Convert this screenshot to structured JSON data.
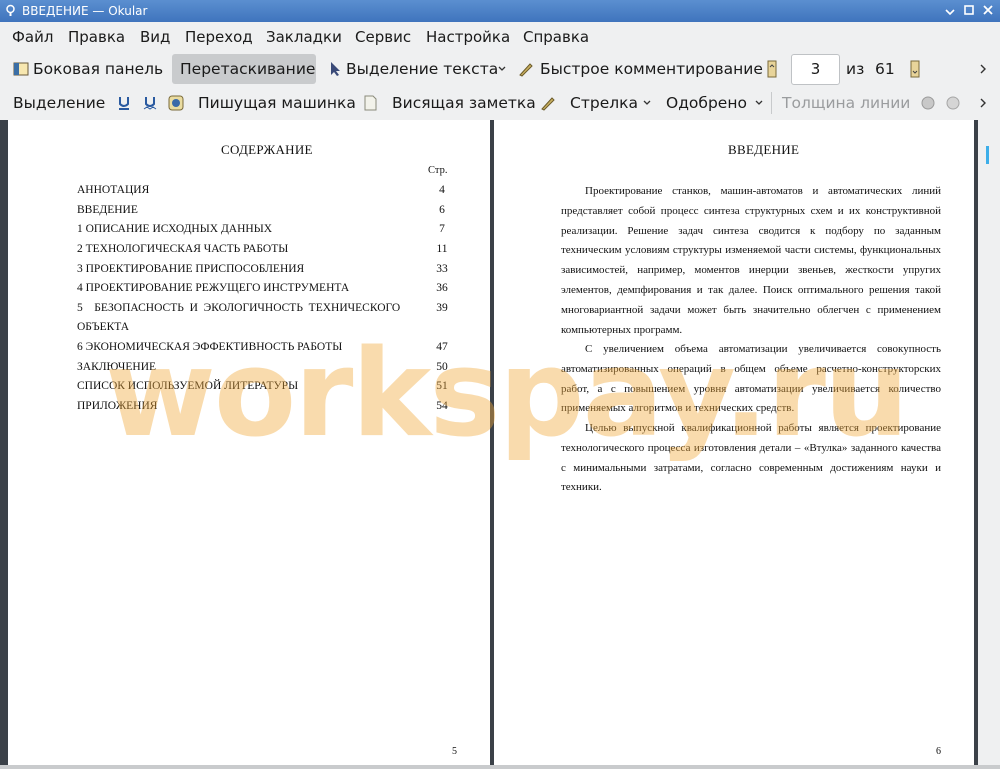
{
  "window": {
    "title": "ВВЕДЕНИЕ  — Okular"
  },
  "menu": [
    "Файл",
    "Правка",
    "Вид",
    "Переход",
    "Закладки",
    "Сервис",
    "Настройка",
    "Справка"
  ],
  "toolbar1": {
    "sidebar": "Боковая панель",
    "drag": "Перетаскивание",
    "text_select": "Выделение текста",
    "quick_comment": "Быстрое комментирование",
    "page_current": "3",
    "page_of": "из",
    "page_total": "61"
  },
  "toolbar2": {
    "selection": "Выделение",
    "typewriter": "Пишущая машинка",
    "hanging_note": "Висящая заметка",
    "arrow": "Стрелка",
    "approved": "Одобрено",
    "line_width": "Толщина линии"
  },
  "left_page": {
    "heading": "СОДЕРЖАНИЕ",
    "col_header": "Стр.",
    "toc": [
      {
        "title": "АННОТАЦИЯ",
        "page": "4"
      },
      {
        "title": "ВВЕДЕНИЕ",
        "page": "6"
      },
      {
        "title": "1  ОПИСАНИЕ ИСХОДНЫХ ДАННЫХ",
        "page": "7"
      },
      {
        "title": "2  ТЕХНОЛОГИЧЕСКАЯ ЧАСТЬ РАБОТЫ",
        "page": "11"
      },
      {
        "title": "3  ПРОЕКТИРОВАНИЕ ПРИСПОСОБЛЕНИЯ",
        "page": "33"
      },
      {
        "title": "4  ПРОЕКТИРОВАНИЕ РЕЖУЩЕГО ИНСТРУМЕНТА",
        "page": "36"
      },
      {
        "title": "5    БЕЗОПАСНОСТЬ  И  ЭКОЛОГИЧНОСТЬ  ТЕХНИЧЕСКОГО",
        "page": "39"
      },
      {
        "title": "ОБЪЕКТА",
        "page": ""
      },
      {
        "title": "6  ЭКОНОМИЧЕСКАЯ ЭФФЕКТИВНОСТЬ РАБОТЫ",
        "page": "47"
      },
      {
        "title": "ЗАКЛЮЧЕНИЕ",
        "page": "50"
      },
      {
        "title": "СПИСОК ИСПОЛЬЗУЕМОЙ ЛИТЕРАТУРЫ",
        "page": "51"
      },
      {
        "title": "ПРИЛОЖЕНИЯ",
        "page": "54"
      }
    ],
    "page_number": "5"
  },
  "right_page": {
    "heading": "ВВЕДЕНИЕ",
    "paragraphs": [
      "Проектирование станков, машин-автоматов и автоматических линий представляет собой процесс синтеза структурных схем и их конструктивной реализации. Решение задач синтеза сводится к подбору по заданным техническим условиям структуры изменяемой части системы, функциональных зависимостей, например, моментов инерции звеньев, жесткости упругих элементов, демпфирования и так далее. Поиск оптимального решения такой многовариантной задачи может быть значительно облегчен с применением компьютерных программ.",
      "С увеличением объема автоматизации увеличивается совокупность автоматизированных операций в общем объеме расчетно-конструкторских работ, а с повышением уровня автоматизации увеличивается количество применяемых алгоритмов и технических средств.",
      "Целью выпускной квалификационной работы является проектирование технологического процесса изготовления детали – «Втулка» заданного качества с минимальными затратами, согласно современным достижениям науки и техники."
    ],
    "page_number": "6"
  },
  "watermark": "workspay.ru",
  "colors": {
    "titlebar": "#4a80c8",
    "toolbar": "#eff0f1",
    "accent": "#3daee9",
    "watermark": "#f0aa3c"
  }
}
